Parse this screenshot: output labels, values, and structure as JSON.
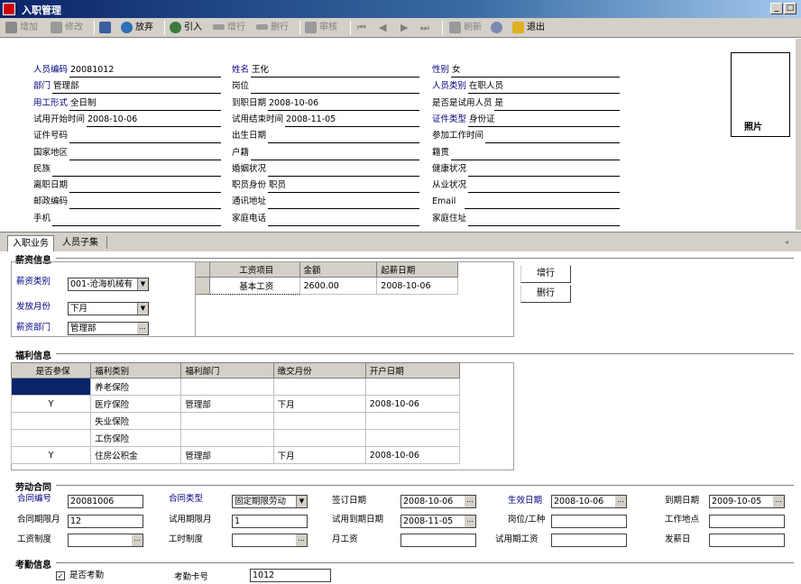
{
  "window": {
    "title": "入职管理",
    "min": "_",
    "max": "□"
  },
  "toolbar": {
    "add": "增加",
    "edit": "修改",
    "save": "",
    "undo": "放弃",
    "import": "引入",
    "add_row": "增行",
    "del_row": "删行",
    "audit": "审核",
    "refresh": "刷新",
    "help": "",
    "exit": "退出"
  },
  "header_fields": {
    "col1": [
      {
        "label": "人员编码",
        "value": "20081012",
        "req": true
      },
      {
        "label": "部门",
        "value": "管理部",
        "req": true
      },
      {
        "label": "用工形式",
        "value": "全日制",
        "req": true
      },
      {
        "label": "试用开始时间",
        "value": "2008-10-06",
        "req": false
      },
      {
        "label": "证件号码",
        "value": "",
        "req": false
      },
      {
        "label": "国家地区",
        "value": "",
        "req": false
      },
      {
        "label": "民族",
        "value": "",
        "req": false
      },
      {
        "label": "离职日期",
        "value": "",
        "req": false
      },
      {
        "label": "邮政编码",
        "value": "",
        "req": false
      },
      {
        "label": "手机",
        "value": "",
        "req": false
      }
    ],
    "col2": [
      {
        "label": "姓名",
        "value": "王化",
        "req": true
      },
      {
        "label": "岗位",
        "value": "",
        "req": false
      },
      {
        "label": "到职日期",
        "value": "2008-10-06",
        "req": false
      },
      {
        "label": "试用结束时间",
        "value": "2008-11-05",
        "req": false
      },
      {
        "label": "出生日期",
        "value": "",
        "req": false
      },
      {
        "label": "户籍",
        "value": "",
        "req": false
      },
      {
        "label": "婚姻状况",
        "value": "",
        "req": false
      },
      {
        "label": "职员身份",
        "value": "职员",
        "req": false
      },
      {
        "label": "通讯地址",
        "value": "",
        "req": false
      },
      {
        "label": "家庭电话",
        "value": "",
        "req": false
      }
    ],
    "col3": [
      {
        "label": "性别",
        "value": "女",
        "req": true
      },
      {
        "label": "人员类别",
        "value": "在职人员",
        "req": true
      },
      {
        "label": "是否是试用人员",
        "value": "是",
        "req": false
      },
      {
        "label": "证件类型",
        "value": "身份证",
        "req": true
      },
      {
        "label": "参加工作时间",
        "value": "",
        "req": false
      },
      {
        "label": "籍贯",
        "value": "",
        "req": false
      },
      {
        "label": "健康状况",
        "value": "",
        "req": false
      },
      {
        "label": "从业状况",
        "value": "",
        "req": false
      },
      {
        "label": "Email",
        "value": "",
        "req": false
      },
      {
        "label": "家庭住址",
        "value": "",
        "req": false
      }
    ]
  },
  "photo_label": "照片",
  "tabs": [
    "入职业务",
    "人员子集"
  ],
  "salary": {
    "section_title": "薪资信息",
    "type_label": "薪资类别",
    "type_value": "001-沧海机械有",
    "month_label": "发放月份",
    "month_value": "下月",
    "dept_label": "薪资部门",
    "dept_value": "管理部",
    "columns": [
      "工资项目",
      "金额",
      "起薪日期"
    ],
    "rows": [
      [
        "基本工资",
        "2600.00",
        "2008-10-06"
      ]
    ],
    "add_btn": "增行",
    "del_btn": "删行"
  },
  "welfare": {
    "section_title": "福利信息",
    "columns": [
      "是否参保",
      "福利类别",
      "福利部门",
      "缴交月份",
      "开户日期"
    ],
    "rows": [
      [
        "",
        "养老保险",
        "",
        "",
        ""
      ],
      [
        "Y",
        "医疗保险",
        "管理部",
        "下月",
        "2008-10-06"
      ],
      [
        "",
        "失业保险",
        "",
        "",
        ""
      ],
      [
        "",
        "工伤保险",
        "",
        "",
        ""
      ],
      [
        "Y",
        "住房公积金",
        "管理部",
        "下月",
        "2008-10-06"
      ]
    ]
  },
  "contract": {
    "section_title": "劳动合同",
    "no_label": "合同编号",
    "no_value": "20081006",
    "type_label": "合同类型",
    "type_value": "固定期限劳动",
    "sign_label": "签订日期",
    "sign_value": "2008-10-06",
    "eff_label": "生效日期",
    "eff_value": "2008-10-06",
    "exp_label": "到期日期",
    "exp_value": "2009-10-05",
    "term_label": "合同期限月",
    "term_value": "12",
    "trial_label": "试用期限月",
    "trial_value": "1",
    "trial_exp_label": "试用到期日期",
    "trial_exp_value": "2008-11-05",
    "post_label": "岗位/工种",
    "post_value": "",
    "place_label": "工作地点",
    "place_value": "",
    "wage_sys_label": "工资制度",
    "wage_sys_value": "",
    "work_sys_label": "工时制度",
    "work_sys_value": "",
    "monthly_label": "月工资",
    "monthly_value": "",
    "trial_wage_label": "试用期工资",
    "trial_wage_value": "",
    "payday_label": "发薪日",
    "payday_value": ""
  },
  "attendance": {
    "section_title": "考勤信息",
    "check_label": "是否考勤",
    "checked": "✓",
    "card_label": "考勤卡号",
    "card_value": "1012"
  }
}
